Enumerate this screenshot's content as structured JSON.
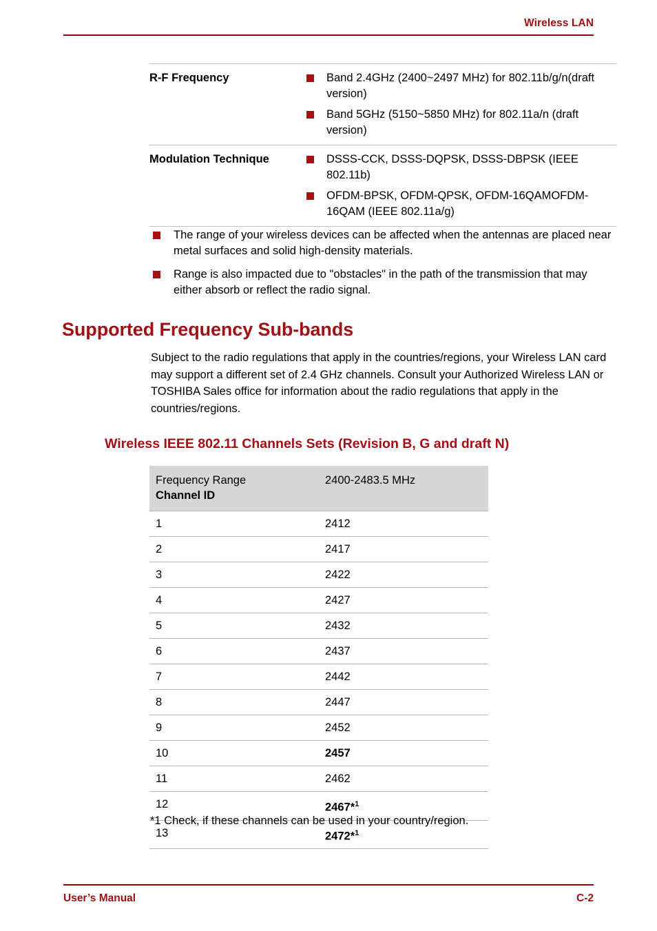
{
  "header": {
    "title": "Wireless LAN"
  },
  "spec_table": {
    "rows": [
      {
        "label": "R-F Frequency",
        "items": [
          "Band 2.4GHz (2400~2497 MHz) for 802.11b/g/n(draft version)",
          "Band 5GHz (5150~5850 MHz) for 802.11a/n (draft version)"
        ]
      },
      {
        "label": "Modulation Technique",
        "items": [
          "DSSS-CCK, DSSS-DQPSK, DSSS-DBPSK (IEEE 802.11b)",
          "OFDM-BPSK, OFDM-QPSK, OFDM-16QAMOFDM-16QAM (IEEE 802.11a/g)"
        ]
      }
    ]
  },
  "notes": [
    "The range of your wireless devices can be affected when the antennas are placed near metal surfaces and solid high-density materials.",
    "Range is also impacted due to \"obstacles\" in the path of the transmission that may either absorb or reflect the radio signal."
  ],
  "section": {
    "heading": "Supported Frequency Sub-bands",
    "paragraph": "Subject to the radio regulations that apply in the countries/regions, your Wireless LAN card may support a different set of 2.4 GHz channels. Consult your Authorized Wireless LAN or TOSHIBA Sales office for information about the radio regulations that apply in the countries/regions."
  },
  "channel_section": {
    "heading": "Wireless IEEE 802.11 Channels Sets (Revision B, G and draft N)",
    "table": {
      "header": {
        "col1_line1": "Frequency Range",
        "col1_line2": "Channel ID",
        "col2": "2400-2483.5 MHz"
      },
      "rows": [
        {
          "id": "1",
          "freq": "2412",
          "bold": false,
          "footnote": ""
        },
        {
          "id": "2",
          "freq": "2417",
          "bold": false,
          "footnote": ""
        },
        {
          "id": "3",
          "freq": "2422",
          "bold": false,
          "footnote": ""
        },
        {
          "id": "4",
          "freq": "2427",
          "bold": false,
          "footnote": ""
        },
        {
          "id": "5",
          "freq": "2432",
          "bold": false,
          "footnote": ""
        },
        {
          "id": "6",
          "freq": "2437",
          "bold": false,
          "footnote": ""
        },
        {
          "id": "7",
          "freq": "2442",
          "bold": false,
          "footnote": ""
        },
        {
          "id": "8",
          "freq": "2447",
          "bold": false,
          "footnote": ""
        },
        {
          "id": "9",
          "freq": "2452",
          "bold": false,
          "footnote": ""
        },
        {
          "id": "10",
          "freq": "2457",
          "bold": true,
          "footnote": ""
        },
        {
          "id": "11",
          "freq": "2462",
          "bold": false,
          "footnote": ""
        },
        {
          "id": "12",
          "freq": "2467",
          "bold": true,
          "footnote": "1"
        },
        {
          "id": "13",
          "freq": "2472",
          "bold": true,
          "footnote": "1"
        }
      ]
    },
    "footnote": "*1 Check, if these channels can be used in your country/region."
  },
  "footer": {
    "left": "User’s Manual",
    "right": "C-2"
  },
  "colors": {
    "brand_red": "#A20F12",
    "rule_red": "#8C0B0B",
    "bullet_red": "#A80F0F",
    "table_header_bg": "#D6D6D6",
    "row_rule": "#B4B4B4"
  }
}
